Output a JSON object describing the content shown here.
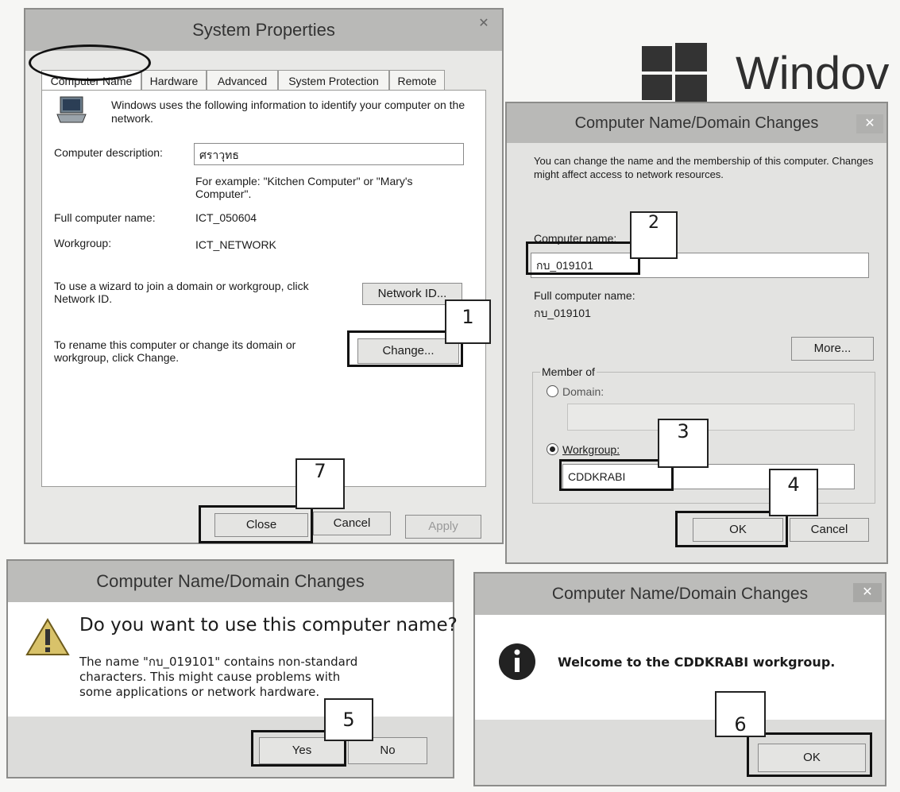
{
  "windows_logo": {
    "text": "Windov"
  },
  "system_properties": {
    "title": "System Properties",
    "close_glyph": "✕",
    "tabs": [
      "Computer Name",
      "Hardware",
      "Advanced",
      "System Protection",
      "Remote"
    ],
    "intro": "Windows uses the following information to identify your computer on the network.",
    "description_label": "Computer description:",
    "description_value": "ศราวุทธ",
    "example_text": "For example: \"Kitchen Computer\" or \"Mary's Computer\".",
    "full_name_label": "Full computer name:",
    "full_name_value": "ICT_050604",
    "workgroup_label": "Workgroup:",
    "workgroup_value": "ICT_NETWORK",
    "wizard_text": "To use a wizard to join a domain or workgroup, click Network ID.",
    "network_id_button": "Network ID...",
    "rename_text": "To rename this computer or change its domain or workgroup, click Change.",
    "change_button": "Change...",
    "close_button": "Close",
    "cancel_button": "Cancel",
    "apply_button": "Apply"
  },
  "domain_changes": {
    "title": "Computer Name/Domain Changes",
    "close_glyph": "✕",
    "intro": "You can change the name and the membership of this computer. Changes might affect access to network resources.",
    "computer_name_label": "Computer name:",
    "computer_name_value": "กบ_019101",
    "full_name_label": "Full computer name:",
    "full_name_value": "กบ_019101",
    "more_button": "More...",
    "member_of_label": "Member of",
    "domain_label": "Domain:",
    "workgroup_label": "Workgroup:",
    "workgroup_value": "CDDKRABI",
    "ok_button": "OK",
    "cancel_button": "Cancel"
  },
  "confirm_dialog": {
    "title": "Computer Name/Domain Changes",
    "heading": "Do you want to use this computer name?",
    "body": "The name \"กบ_019101\" contains non-standard characters. This might cause problems with some applications or network hardware.",
    "yes_button": "Yes",
    "no_button": "No"
  },
  "welcome_dialog": {
    "title": "Computer Name/Domain Changes",
    "close_glyph": "✕",
    "message": "Welcome to the CDDKRABI workgroup.",
    "ok_button": "OK"
  },
  "callouts": [
    "1",
    "2",
    "3",
    "4",
    "5",
    "6",
    "7"
  ]
}
